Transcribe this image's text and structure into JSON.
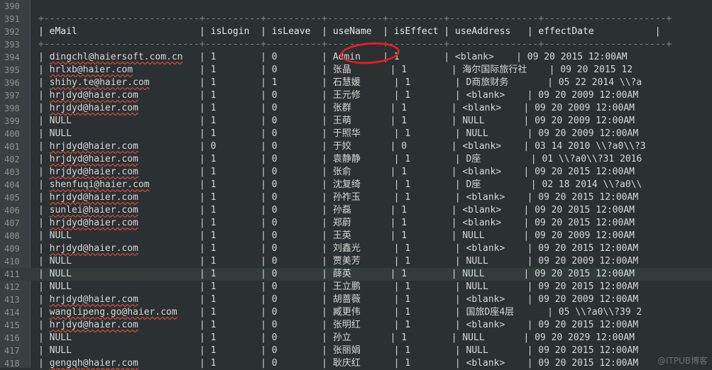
{
  "lines": [
    {
      "n": "390",
      "t": ""
    },
    {
      "n": "391",
      "t": "+----------------------------+----------+----------+----------+----------+----------------+----------------------+",
      "kind": "sep"
    },
    {
      "n": "392",
      "t": "| eMail                      | isLogin  | isLeave  | useName  | isEffect | useAddress   | effectDate           |",
      "kind": "hdr"
    },
    {
      "n": "393",
      "t": "+----------------------------+----------+----------+----------+----------+----------------+----------------------+",
      "kind": "sep"
    },
    {
      "n": "394",
      "t": "| dingchl@haiersoft.com.cn   | 1        | 0        | Admin    | 1        | <blank>    | 09 20 2015 12:00AM",
      "ul": true
    },
    {
      "n": "395",
      "t": "| hrlxb@haier.com            | 1        | 0        | 张晶       | 1        | 海尔国际旅行社    | 09 20 2015 12",
      "ul": true
    },
    {
      "n": "396",
      "t": "| shihy.te@haier.com         | 1        | 1        | 石慧媛      | 1        | D商旅财务       | 05 22 2014 \\\\?a",
      "ul": true
    },
    {
      "n": "397",
      "t": "| hrjdyd@haier.com           | 1        | 0        | 王元修      | 1        | <blank>    | 09 20 2009 12:00AM",
      "ul": true
    },
    {
      "n": "398",
      "t": "| hrjdyd@haier.com           | 1        | 0        | 张群       | 1        | <blank>    | 09 20 2009 12:00AM",
      "ul": true
    },
    {
      "n": "399",
      "t": "| NULL                       | 1        | 0        | 王萌       | 1        | NULL       | 09 20 2009 12:00AM"
    },
    {
      "n": "400",
      "t": "| NULL                       | 1        | 0        | 于照华      | 1        | NULL       | 09 20 2009 12:00AM"
    },
    {
      "n": "401",
      "t": "| hrjdyd@haier.com           | 0        | 0        | 于姣       | 0        | <blank>    | 03 14 2010 \\\\?a0\\\\?3",
      "ul": true
    },
    {
      "n": "402",
      "t": "| hrjdyd@haier.com           | 1        | 0        | 袁静静      | 1        | D座         | 01 \\\\?a0\\\\?31 2016",
      "ul": true
    },
    {
      "n": "403",
      "t": "| hrjdyd@haier.com           | 1        | 0        | 张俞       | 1        | <blank>    | 09 20 2015 12:00AM",
      "ul": true
    },
    {
      "n": "404",
      "t": "| shenfuqi@haier.com         | 1        | 0        | 沈复绮      | 1        | D座         | 02 18 2014 \\\\?a0\\\\",
      "ul": true
    },
    {
      "n": "405",
      "t": "| hrjdyd@haier.com           | 1        | 0        | 孙祚玉      | 1        | <blank>    | 09 20 2015 12:00AM",
      "ul": true
    },
    {
      "n": "406",
      "t": "| sunlei@haier.com           | 1        | 0        | 孙磊       | 1        | <blank>    | 09 20 2015 12:00AM",
      "ul": true
    },
    {
      "n": "407",
      "t": "| hrjdyd@haier.com           | 1        | 0        | 郑蔚       | 1        | <blank>    | 09 20 2015 12:00AM",
      "ul": true
    },
    {
      "n": "408",
      "t": "| NULL                       | 1        | 0        | 王英       | 1        | NULL       | 09 20 2009 12:00AM"
    },
    {
      "n": "409",
      "t": "| hrjdyd@haier.com           | 1        | 0        | 刘鑫光      | 1        | <blank>    | 09 20 2015 12:00AM",
      "ul": true
    },
    {
      "n": "410",
      "t": "| NULL                       | 1        | 0        | 贾美芳      | 1        | NULL       | 09 20 2009 12:00AM"
    },
    {
      "n": "411",
      "t": "| NULL                       | 1        | 0        | 薛英       | 1        | NULL       | 09 20 2015 12:00AM",
      "hl": true
    },
    {
      "n": "412",
      "t": "| NULL                       | 1        | 0        | 王立鹏      | 1        | NULL       | 09 20 2015 12:00AM"
    },
    {
      "n": "413",
      "t": "| hrjdyd@haier.com           | 1        | 0        | 胡蔷薇      | 1        | <blank>    | 09 20 2009 12:00AM",
      "ul": true
    },
    {
      "n": "414",
      "t": "| wanglipeng.go@haier.com    | 1        | 0        | 臧更伟      | 1        | 国旅D座4层      | 05 \\\\?a0\\\\?39 2",
      "ul": true
    },
    {
      "n": "415",
      "t": "| hrjdyd@haier.com           | 1        | 0        | 张明红      | 1        | <blank>    | 09 20 2015 12:00AM",
      "ul": true
    },
    {
      "n": "416",
      "t": "| NULL                       | 1        | 0        | 孙立       | 1        | NULL       | 09 20 2029 12:00AM"
    },
    {
      "n": "417",
      "t": "| NULL                       | 1        | 0        | 张丽娟      | 1        | NULL       | 09 20 2015 12:00AM"
    },
    {
      "n": "418",
      "t": "| gengqh@haier.com           | 1        | 0        | 耿庆红      | 1        | <blank>    | 09 20 2015 12:00AM",
      "ul": true
    }
  ],
  "watermark": "@ITPUB博客"
}
